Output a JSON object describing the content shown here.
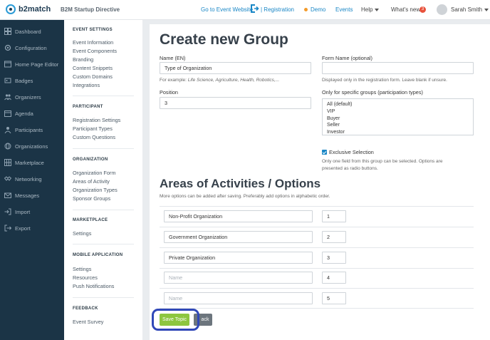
{
  "header": {
    "logo_text": "b2match",
    "event_name": "B2M Startup Directive",
    "go_to_event": "Go to Event Website",
    "registration": "| Registration",
    "demo": "Demo",
    "events": "Events",
    "help": "Help",
    "whats_new": "What's new",
    "whats_new_count": "3",
    "user_name": "Sarah Smith",
    "colors": {
      "link": "#1a87c6",
      "demo_dot": "#f39a2a",
      "badge": "#e8523c"
    }
  },
  "sidebar": {
    "items": [
      {
        "label": "Dashboard",
        "icon": "dashboard-icon"
      },
      {
        "label": "Configuration",
        "icon": "settings-icon"
      },
      {
        "label": "Home Page Editor",
        "icon": "window-icon"
      },
      {
        "label": "Badges",
        "icon": "badge-icon"
      },
      {
        "label": "Organizers",
        "icon": "people-icon"
      },
      {
        "label": "Agenda",
        "icon": "calendar-icon"
      },
      {
        "label": "Participants",
        "icon": "users-icon"
      },
      {
        "label": "Organizations",
        "icon": "globe-icon"
      },
      {
        "label": "Marketplace",
        "icon": "grid-icon"
      },
      {
        "label": "Networking",
        "icon": "handshake-icon"
      },
      {
        "label": "Messages",
        "icon": "envelope-icon"
      },
      {
        "label": "Import",
        "icon": "import-icon"
      },
      {
        "label": "Export",
        "icon": "export-icon"
      }
    ]
  },
  "subnav": {
    "event_settings": {
      "title": "EVENT SETTINGS",
      "items": [
        "Event Information",
        "Event Components",
        "Branding",
        "Content Snippets",
        "Custom Domains",
        "Integrations"
      ]
    },
    "participant": {
      "title": "PARTICIPANT",
      "items": [
        "Registration Settings",
        "Participant Types",
        "Custom Questions"
      ]
    },
    "organization": {
      "title": "ORGANIZATION",
      "items": [
        "Organization Form",
        "Areas of Activity",
        "Organization Types",
        "Sponsor Groups"
      ]
    },
    "marketplace": {
      "title": "MARKETPLACE",
      "items": [
        "Settings"
      ]
    },
    "mobile_application": {
      "title": "MOBILE APPLICATION",
      "items": [
        "Settings",
        "Resources",
        "Push Notifications"
      ]
    },
    "feedback": {
      "title": "FEEDBACK",
      "items": [
        "Event Survey"
      ]
    }
  },
  "form": {
    "title": "Create new Group",
    "name_label": "Name (EN)",
    "name_value": "Type of Organization",
    "name_hint_prefix": "For example: ",
    "name_hint_examples": "Life Science, Agriculture, Health, Robotics,...",
    "position_label": "Position",
    "position_value": "3",
    "form_name_label": "Form Name (optional)",
    "form_name_value": "",
    "form_name_hint": "Displayed only in the registration form. Leave blank if unsure.",
    "groups_label": "Only for specific groups (participation types)",
    "groups_options": [
      "All (default)",
      "VIP",
      "Buyer",
      "Seller",
      "Investor"
    ],
    "exclusive_label": "Exclusive Selection",
    "exclusive_checked": true,
    "exclusive_hint_1": "Only one field from this group can be selected. Options are",
    "exclusive_hint_2": "presented as radio buttons."
  },
  "options": {
    "title": "Areas of Activities / Options",
    "hint": "More options can be added after saving. Preferably add options in alphabetic order.",
    "rows": [
      {
        "name": "Non-Profit Organization",
        "position": "1"
      },
      {
        "name": "Government Organization",
        "position": "2"
      },
      {
        "name": "Private Organization",
        "position": "3"
      },
      {
        "name": "",
        "position": "4"
      },
      {
        "name": "",
        "position": "5"
      }
    ],
    "name_placeholder": "Name"
  },
  "buttons": {
    "save": "Save Topic",
    "back": "ack",
    "save_color": "#8dc63f"
  }
}
